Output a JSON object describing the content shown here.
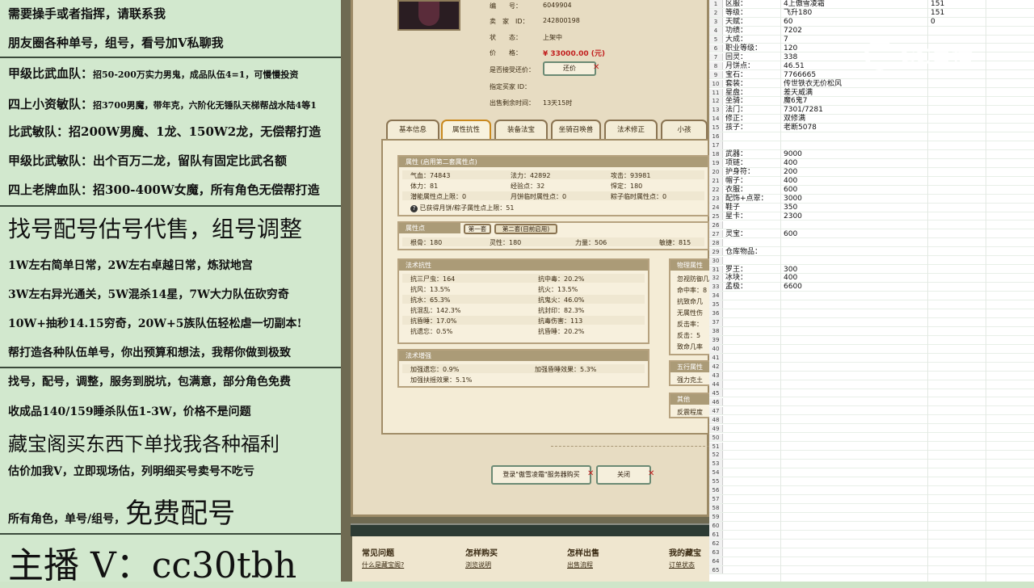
{
  "left_panel": {
    "lines": [
      {
        "text": "需要操手或者指挥，请联系我"
      },
      {
        "text": "朋友圈各种单号，组号，看号加V私聊我"
      },
      {
        "title": "甲级比武血队：",
        "desc": "招50-200万实力男鬼，成品队伍4=1，可慢慢投资"
      },
      {
        "title": "四上小资敏队：",
        "desc": "招3700男魔，带年克，六阶化无锤队天梯帮战水陆4等1"
      },
      {
        "text": "比武敏队：招200W男魔、1龙、150W2龙，无偿帮打造"
      },
      {
        "text": "甲级比武敏队：出个百万二龙，留队有固定比武名额"
      },
      {
        "text": "四上老牌血队：招300-400W女魔，所有角色无偿帮打造"
      },
      {
        "text": "找号配号估号代售，组号调整"
      },
      {
        "text": "1W左右简单日常，2W左右卓越日常，炼狱地宫"
      },
      {
        "text": "3W左右异光通关，5W混杀14星，7W大力队伍砍穷奇"
      },
      {
        "text": "10W+抽秒14.15穷奇，20W+5族队伍轻松虐一切副本!"
      },
      {
        "text": "帮打造各种队伍单号，你出预算和想法，我帮你做到极致"
      },
      {
        "text": "找号，配号，调整，服务到脱坑，包满意，部分角色免费"
      },
      {
        "text": "收成品140/159睡杀队伍1-3W，价格不是问题"
      },
      {
        "text": "藏宝阁买东西下单找我各种福利"
      },
      {
        "text": "估价加我V，立即现场估，列明细买号卖号不吃亏"
      },
      {
        "small": "所有角色，单号/组号，",
        "big": "免费配号"
      },
      {
        "text": "主播 V：cc30tbh"
      }
    ]
  },
  "game": {
    "info_labels": [
      "编　　号：",
      "卖　家　ID：",
      "状　　态：",
      "价　　格：",
      "是否接受还价：",
      "指定买家 ID：",
      "出售剩余时间："
    ],
    "info_values": [
      "6049904",
      "242800198",
      "上架中",
      "¥ 33000.00 (元)",
      "",
      "",
      "13天15时"
    ],
    "haggle_button": "还价",
    "tabs": [
      "基本信息",
      "属性抗性",
      "装备法宝",
      "坐骑召唤兽",
      "法术修正",
      "小孩"
    ],
    "attr_header": "属性 (启用第二套属性点)",
    "attr_rows": [
      [
        "气血：74843",
        "法力：42892",
        "攻击：93981"
      ],
      [
        "体力：81",
        "经验点：32",
        "悍定：180"
      ],
      [
        "潜能属性点上限：0",
        "月饼临时属性点：0",
        "粽子临时属性点：0"
      ]
    ],
    "attr_note": "已获得月饼/粽子属性点上限：51",
    "points_header": "属性点",
    "points_tabs": [
      "第一套",
      "第二套(目前启用)"
    ],
    "points_row": [
      "根骨：180",
      "灵性：180",
      "力量：506",
      "敏捷：815"
    ],
    "resist_header": "法术抗性",
    "resist_rows": [
      [
        "抗三尸虫：164",
        "抗中毒：20.2%"
      ],
      [
        "抗风：13.5%",
        "抗火：13.5%"
      ],
      [
        "抗水：65.3%",
        "抗鬼火：46.0%"
      ],
      [
        "抗混乱：142.3%",
        "抗封印：82.3%"
      ],
      [
        "抗昏睡：17.0%",
        "抗毒伤害：113"
      ],
      [
        "抗遗忘：0.5%",
        "抗昏睡：20.2%"
      ]
    ],
    "boost_header": "法术增强",
    "boost_rows": [
      [
        "加强遗忘：0.9%",
        "加强昏睡效果：5.3%"
      ],
      [
        "加强扶摇效果：5.1%",
        ""
      ]
    ],
    "phys_header": "物理属性",
    "phys_rows": [
      "忽视防御几",
      "命中率：8",
      "抗致命几",
      "无属性伤",
      "反击率：",
      "反击：5",
      "致命几率"
    ],
    "five_header": "五行属性",
    "five_row": "强力克土",
    "other_header": "其他",
    "other_row": "反震程度",
    "login_button": "登录\"傲雪凌霜\"服务器购买",
    "close_button": "关闭",
    "footer_heads": [
      "常见问题",
      "怎样购买",
      "怎样出售",
      "我的藏宝"
    ],
    "footer_links": [
      "什么是藏宝阁?",
      "浏览说明",
      "出售流程",
      "订单状态"
    ]
  },
  "overlay": {
    "brand": "CC直播"
  },
  "sheet": {
    "rows": [
      [
        "1",
        "区服：",
        "4上傲雪凌霜",
        "151",
        ""
      ],
      [
        "2",
        "等级：",
        "飞升180",
        "151",
        ""
      ],
      [
        "3",
        "天赋：",
        "60",
        "0",
        ""
      ],
      [
        "4",
        "功绩：",
        "7202",
        "",
        ""
      ],
      [
        "5",
        "大成：",
        "7",
        "",
        ""
      ],
      [
        "6",
        "职业等级：",
        "120",
        "",
        ""
      ],
      [
        "7",
        "回灵：",
        "338",
        "",
        ""
      ],
      [
        "8",
        "月饼点：",
        "46.51",
        "",
        ""
      ],
      [
        "9",
        "宝石：",
        "7766665",
        "",
        ""
      ],
      [
        "10",
        "套装：",
        "传世铁衣无价松风",
        "",
        ""
      ],
      [
        "11",
        "星盘：",
        "差天威满",
        "",
        ""
      ],
      [
        "12",
        "坐骑：",
        "魔6鬼7",
        "",
        ""
      ],
      [
        "13",
        "法门：",
        "7301/7281",
        "",
        ""
      ],
      [
        "14",
        "修正：",
        "双修满",
        "",
        ""
      ],
      [
        "15",
        "孩子：",
        "老断5078",
        "",
        ""
      ],
      [
        "16",
        "",
        "",
        "",
        ""
      ],
      [
        "17",
        "",
        "",
        "",
        ""
      ],
      [
        "18",
        "武器：",
        "9000",
        "",
        ""
      ],
      [
        "19",
        "项链：",
        "400",
        "",
        ""
      ],
      [
        "20",
        "护身符：",
        "200",
        "",
        ""
      ],
      [
        "21",
        "帽子：",
        "400",
        "",
        ""
      ],
      [
        "22",
        "衣服：",
        "600",
        "",
        ""
      ],
      [
        "23",
        "配饰+点翠：",
        "3000",
        "",
        ""
      ],
      [
        "24",
        "鞋子",
        "350",
        "",
        ""
      ],
      [
        "25",
        "星卡：",
        "2300",
        "",
        ""
      ],
      [
        "26",
        "",
        "",
        "",
        ""
      ],
      [
        "27",
        "灵宝：",
        "600",
        "",
        ""
      ],
      [
        "28",
        "",
        "",
        "",
        ""
      ],
      [
        "29",
        "仓库物品：",
        "",
        "",
        ""
      ],
      [
        "30",
        "",
        "",
        "",
        ""
      ],
      [
        "31",
        "罗王：",
        "300",
        "",
        ""
      ],
      [
        "32",
        "冰块：",
        "400",
        "",
        ""
      ],
      [
        "33",
        "孟极：",
        "6600",
        "",
        ""
      ],
      [
        "34",
        "",
        "",
        "",
        ""
      ],
      [
        "35",
        "",
        "",
        "",
        ""
      ],
      [
        "36",
        "",
        "",
        "",
        ""
      ],
      [
        "37",
        "",
        "",
        "",
        ""
      ],
      [
        "38",
        "",
        "",
        "",
        ""
      ],
      [
        "39",
        "",
        "",
        "",
        ""
      ],
      [
        "40",
        "",
        "",
        "",
        ""
      ],
      [
        "41",
        "",
        "",
        "",
        ""
      ],
      [
        "42",
        "",
        "",
        "",
        ""
      ],
      [
        "43",
        "",
        "",
        "",
        ""
      ],
      [
        "44",
        "",
        "",
        "",
        ""
      ],
      [
        "45",
        "",
        "",
        "",
        ""
      ],
      [
        "46",
        "",
        "",
        "",
        ""
      ],
      [
        "47",
        "",
        "",
        "",
        ""
      ],
      [
        "48",
        "",
        "",
        "",
        ""
      ],
      [
        "49",
        "",
        "",
        "",
        ""
      ],
      [
        "50",
        "",
        "",
        "",
        ""
      ],
      [
        "51",
        "",
        "",
        "",
        ""
      ],
      [
        "52",
        "",
        "",
        "",
        ""
      ],
      [
        "53",
        "",
        "",
        "",
        ""
      ],
      [
        "54",
        "",
        "",
        "",
        ""
      ],
      [
        "55",
        "",
        "",
        "",
        ""
      ],
      [
        "56",
        "",
        "",
        "",
        ""
      ],
      [
        "57",
        "",
        "",
        "",
        ""
      ],
      [
        "58",
        "",
        "",
        "",
        ""
      ],
      [
        "59",
        "",
        "",
        "",
        ""
      ],
      [
        "60",
        "",
        "",
        "",
        ""
      ],
      [
        "61",
        "",
        "",
        "",
        ""
      ],
      [
        "62",
        "",
        "",
        "",
        ""
      ],
      [
        "63",
        "",
        "",
        "",
        ""
      ],
      [
        "64",
        "",
        "",
        "",
        ""
      ],
      [
        "65",
        "",
        "",
        "",
        ""
      ]
    ],
    "visible_row_numbers": [
      "1",
      "2",
      "3",
      "4",
      "5",
      "6",
      "7",
      "8",
      "9",
      "10",
      "11",
      "12",
      "13",
      "14",
      "15",
      "16",
      "17",
      "18",
      "19",
      "20",
      "21",
      "22",
      "23",
      "24",
      "25",
      "26",
      "27",
      "28",
      "29",
      "30",
      "31",
      "32",
      "33",
      "34",
      "35",
      "36",
      "37",
      "38",
      "39",
      "40",
      "41",
      "42",
      "43",
      "44",
      "45",
      "46",
      "47",
      "48",
      "49",
      "50",
      "51",
      "52",
      "53",
      "54",
      "55",
      "56",
      "57",
      "58",
      "59",
      "60",
      "61",
      "62",
      "63",
      "64",
      "65"
    ]
  },
  "colors": {
    "left_bg": "#d2e8ce",
    "price": "#c21f1f",
    "panel_head": "#ab9b77",
    "tab_active": "#c9891f"
  }
}
